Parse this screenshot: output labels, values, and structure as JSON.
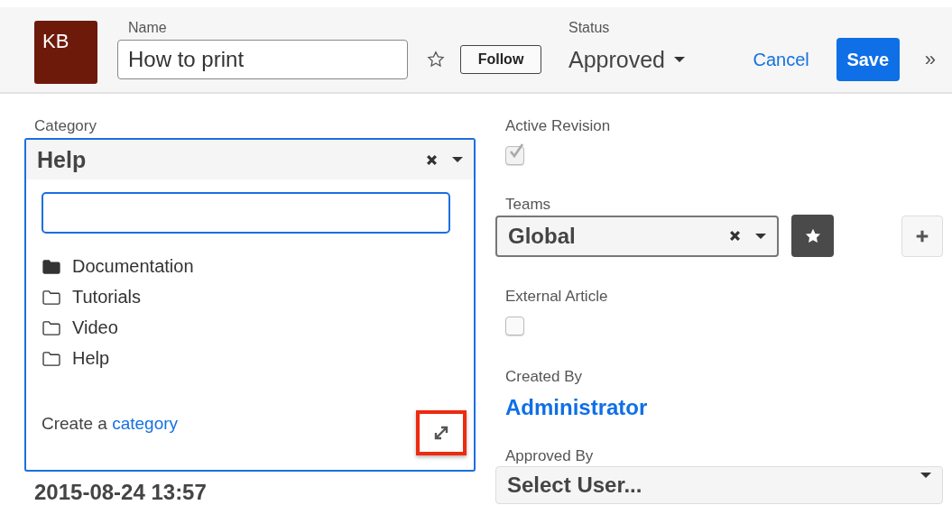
{
  "header": {
    "avatar": "KB",
    "name_label": "Name",
    "name_value": "How to print",
    "favorite": false,
    "follow_button": "Follow",
    "status_label": "Status",
    "status_value": "Approved",
    "cancel": "Cancel",
    "save": "Save",
    "more": "»"
  },
  "category": {
    "label": "Category",
    "value": "Help",
    "items": [
      {
        "label": "Documentation",
        "has_children": true
      },
      {
        "label": "Tutorials",
        "has_children": false
      },
      {
        "label": "Video",
        "has_children": false
      },
      {
        "label": "Help",
        "has_children": false
      }
    ],
    "create_text": "Create a ",
    "create_link": "category",
    "expand_highlighted": true
  },
  "date_value": "2015-08-24 13:57",
  "active_revision": {
    "label": "Active Revision",
    "checked": true,
    "disabled": true
  },
  "teams": {
    "label": "Teams",
    "value": "Global",
    "primary": true
  },
  "external_article": {
    "label": "External Article",
    "checked": false
  },
  "created_by": {
    "label": "Created By",
    "value": "Administrator"
  },
  "approved_by": {
    "label": "Approved By",
    "placeholder": "Select User..."
  }
}
